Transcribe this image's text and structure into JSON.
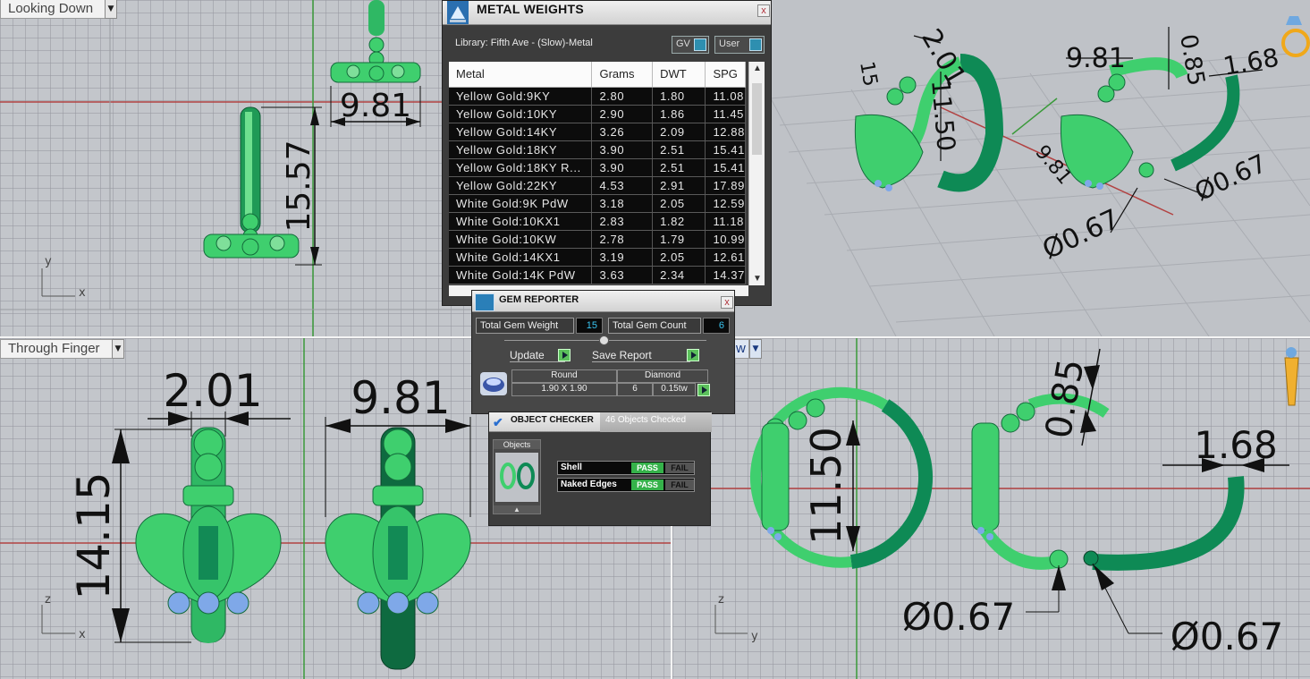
{
  "viewports": {
    "top_left": {
      "title": "Looking Down",
      "axis_x": "x",
      "axis_y": "y",
      "dim_width": "9.81",
      "dim_height": "15.57"
    },
    "top_right": {
      "dims": [
        "2.01",
        "9.81",
        "0.85",
        "1.68",
        "11.50",
        "15",
        "9.81",
        "Ø0.67",
        "Ø0.67"
      ]
    },
    "bottom_left": {
      "title": "Through Finger",
      "axis_x": "x",
      "axis_z": "z",
      "dim_width_1": "2.01",
      "dim_width_2": "9.81",
      "dim_height": "14.15"
    },
    "bottom_right": {
      "title_fragment": "w",
      "axis_y": "y",
      "axis_z": "z",
      "dim_diameter": "11.50",
      "dim_thickness": "0.85",
      "dim_band": "1.68",
      "dim_hole_1": "Ø0.67",
      "dim_hole_2": "Ø0.67"
    }
  },
  "metal_weights": {
    "title": "METAL WEIGHTS",
    "close": "x",
    "library": "Library: Fifth Ave - (Slow)-Metal",
    "gv_label": "GV",
    "user_label": "User",
    "columns": [
      "Metal",
      "Grams",
      "DWT",
      "SPG"
    ],
    "rows": [
      [
        "Yellow Gold:9KY",
        "2.80",
        "1.80",
        "11.08"
      ],
      [
        "Yellow Gold:10KY",
        "2.90",
        "1.86",
        "11.45"
      ],
      [
        "Yellow Gold:14KY",
        "3.26",
        "2.09",
        "12.88"
      ],
      [
        "Yellow Gold:18KY",
        "3.90",
        "2.51",
        "15.41"
      ],
      [
        "Yellow Gold:18KY R...",
        "3.90",
        "2.51",
        "15.41"
      ],
      [
        "Yellow Gold:22KY",
        "4.53",
        "2.91",
        "17.89"
      ],
      [
        "White Gold:9K PdW",
        "3.18",
        "2.05",
        "12.59"
      ],
      [
        "White Gold:10KX1",
        "2.83",
        "1.82",
        "11.18"
      ],
      [
        "White Gold:10KW",
        "2.78",
        "1.79",
        "10.99"
      ],
      [
        "White Gold:14KX1",
        "3.19",
        "2.05",
        "12.61"
      ],
      [
        "White Gold:14K PdW",
        "3.63",
        "2.34",
        "14.37"
      ]
    ],
    "scroll_up": "▲",
    "scroll_down": "▼"
  },
  "gem_reporter": {
    "title": "GEM REPORTER",
    "close": "x",
    "total_weight_label": "Total Gem Weight",
    "total_weight_value": "15",
    "total_count_label": "Total Gem Count",
    "total_count_value": "6",
    "update_label": "Update",
    "save_label": "Save Report",
    "gem": {
      "shape": "Round",
      "size": "1.90 X 1.90",
      "type": "Diamond",
      "count": "6",
      "weight": "0.15tw"
    }
  },
  "object_checker": {
    "title": "OBJECT CHECKER",
    "tab2": "46  Objects Checked",
    "objects_label": "Objects",
    "up_arrow": "▲",
    "checks": [
      {
        "label": "Shell",
        "pass": "PASS",
        "fail": "FAIL"
      },
      {
        "label": "Naked Edges",
        "pass": "PASS",
        "fail": "FAIL"
      }
    ]
  },
  "colors": {
    "ring_light": "#3fcf6e",
    "ring_dark": "#0e8a55",
    "gem": "#7fa8e8",
    "panel_bg": "#3c3c3c",
    "pass": "#35b24a"
  }
}
